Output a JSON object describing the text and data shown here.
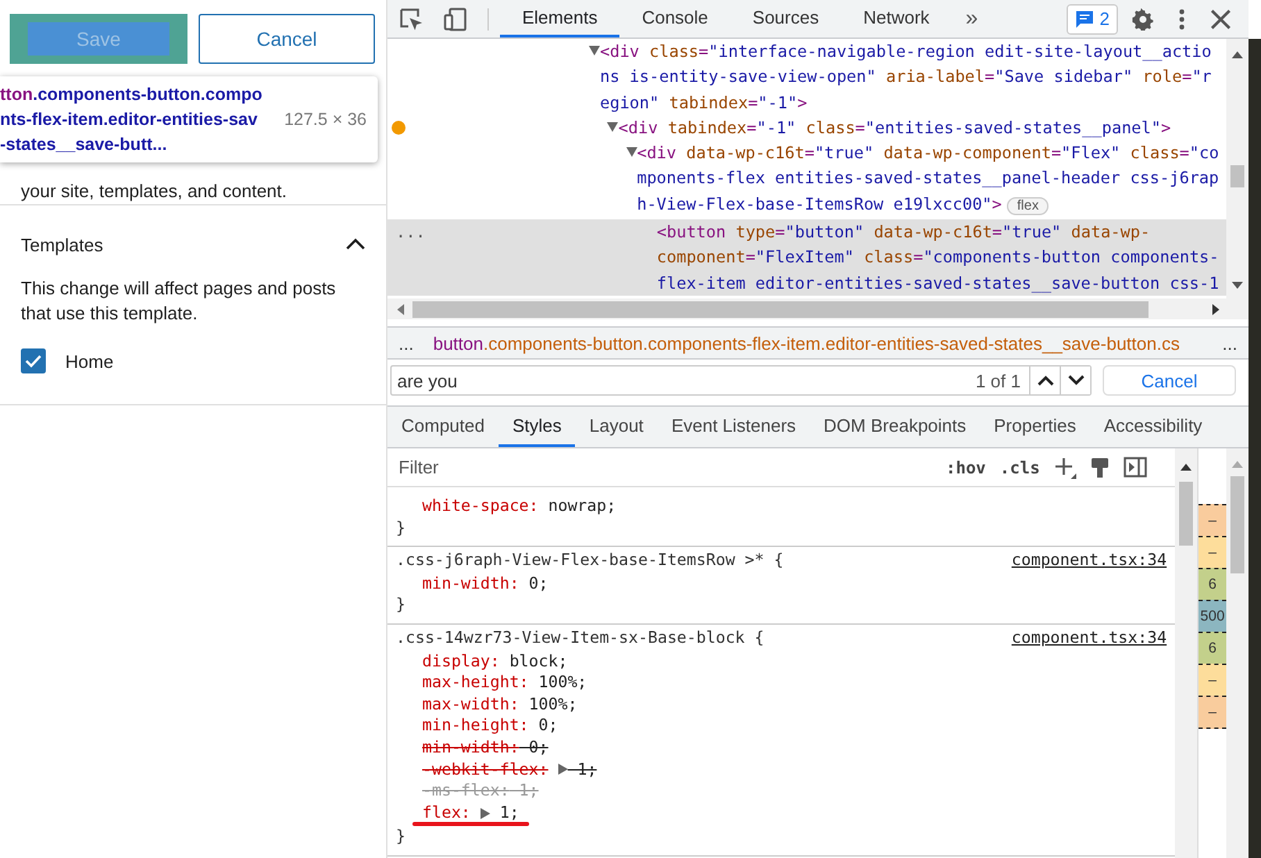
{
  "sidebar": {
    "save_button": {
      "label": "Save",
      "inspected": true
    },
    "cancel_button": {
      "label": "Cancel"
    },
    "inspect_tooltip": {
      "tag": "tton",
      "lines": [
        ".components-button.compo",
        "nts-flex-item.editor-entities-sav",
        "-states__save-butt..."
      ],
      "size": "127.5 × 36"
    },
    "intro": "your site, templates, and content.",
    "section": {
      "title": "Templates",
      "expanded": true,
      "description": "This change will affect pages and posts that use this template.",
      "items": [
        {
          "label": "Home",
          "checked": true
        }
      ]
    }
  },
  "devtools": {
    "tabs": [
      {
        "label": "Elements",
        "selected": true
      },
      {
        "label": "Console",
        "selected": false
      },
      {
        "label": "Sources",
        "selected": false
      },
      {
        "label": "Network",
        "selected": false
      }
    ],
    "more_tabs": "»",
    "issues_count": "2",
    "dom_tree": [
      {
        "lines": [
          "<div class=\"interface-navigable-region edit-site-layout__actio",
          "ns is-entity-save-view-open\" aria-label=\"Save sidebar\" role=\"r",
          "egion\" tabindex=\"-1\">"
        ],
        "expanded": true,
        "selected": false,
        "flagged": false,
        "children": [
          {
            "lines": [
              "<div tabindex=\"-1\" class=\"entities-saved-states__panel\">"
            ],
            "expanded": true,
            "selected": false,
            "flagged": true,
            "children": [
              {
                "lines": [
                  "<div data-wp-c16t=\"true\" data-wp-component=\"Flex\" class=\"co",
                  "mponents-flex entities-saved-states__panel-header css-j6rap",
                  "h-View-Flex-base-ItemsRow e19lxcc00\">"
                ],
                "badge": "flex",
                "expanded": true,
                "selected": false,
                "flagged": false,
                "children": [
                  {
                    "lines": [
                      "<button type=\"button\" data-wp-c16t=\"true\" data-wp-",
                      "component=\"FlexItem\" class=\"components-button components-",
                      "flex-item editor-entities-saved-states__save-button css-1"
                    ],
                    "selected": true,
                    "flagged": false,
                    "menu": "..."
                  }
                ]
              }
            ]
          }
        ]
      }
    ],
    "breadcrumb": {
      "left": "...",
      "tag": "button",
      "classes": ".components-button.components-flex-item.editor-entities-saved-states__save-button.cs",
      "right": "..."
    },
    "search": {
      "value": "are you",
      "count": "1 of 1",
      "cancel": "Cancel"
    },
    "style_tabs": [
      {
        "label": "Computed",
        "selected": false
      },
      {
        "label": "Styles",
        "selected": true
      },
      {
        "label": "Layout",
        "selected": false
      },
      {
        "label": "Event Listeners",
        "selected": false
      },
      {
        "label": "DOM Breakpoints",
        "selected": false
      },
      {
        "label": "Properties",
        "selected": false
      },
      {
        "label": "Accessibility",
        "selected": false
      }
    ],
    "filter": {
      "placeholder": "Filter",
      "hov": ":hov",
      "cls": ".cls"
    },
    "rules": [
      {
        "properties": [
          {
            "text": "white-space: nowrap;",
            "overridden": false,
            "invalid": false
          }
        ],
        "close": "}"
      },
      {
        "selector": ".css-j6raph-View-Flex-base-ItemsRow >* {",
        "source": "component.tsx:34",
        "properties": [
          {
            "text": "min-width: 0;",
            "overridden": false,
            "invalid": false
          }
        ],
        "close": "}"
      },
      {
        "selector": ".css-14wzr73-View-Item-sx-Base-block {",
        "source": "component.tsx:34",
        "properties": [
          {
            "text": "display: block;",
            "overridden": false,
            "invalid": false
          },
          {
            "text": "max-height: 100%;",
            "overridden": false,
            "invalid": false
          },
          {
            "text": "max-width: 100%;",
            "overridden": false,
            "invalid": false
          },
          {
            "text": "min-height: 0;",
            "overridden": false,
            "invalid": false
          },
          {
            "text": "min-width: 0;",
            "overridden": true,
            "invalid": false
          },
          {
            "text": "-webkit-flex: 1;",
            "overridden": true,
            "invalid": false,
            "expandable": true
          },
          {
            "text": "-ms-flex: 1;",
            "overridden": true,
            "invalid": true
          },
          {
            "text": "flex: 1;",
            "overridden": false,
            "invalid": false,
            "expandable": true,
            "underlined": true
          }
        ],
        "close": "}"
      }
    ],
    "box_model": [
      {
        "value": "–",
        "color": "#f9cc9d"
      },
      {
        "value": "–",
        "color": "#fddd9b"
      },
      {
        "value": "6",
        "color": "#c3d08b"
      },
      {
        "value": "500",
        "color": "#8cb6c0"
      },
      {
        "value": "6",
        "color": "#c3d08b"
      },
      {
        "value": "–",
        "color": "#fddd9b"
      },
      {
        "value": "–",
        "color": "#f9cc9d"
      }
    ]
  }
}
